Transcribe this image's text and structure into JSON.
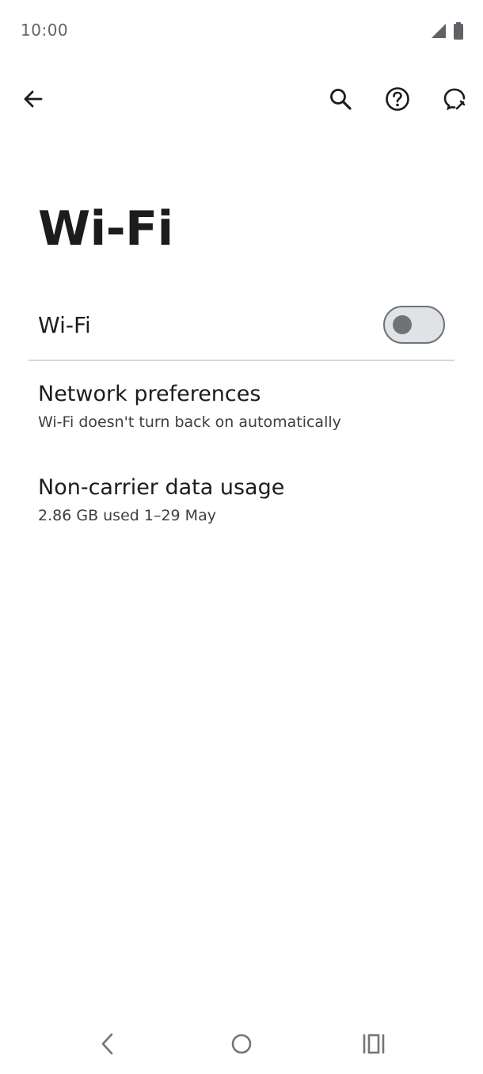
{
  "status_bar": {
    "time": "10:00",
    "icons": [
      "cellular-signal-icon",
      "battery-icon"
    ]
  },
  "app_bar": {
    "icons": [
      "back-arrow-icon",
      "search-icon",
      "help-icon",
      "feedback-icon"
    ]
  },
  "page": {
    "title": "Wi-Fi"
  },
  "wifi_toggle": {
    "label": "Wi-Fi",
    "state": "off"
  },
  "items": [
    {
      "title": "Network preferences",
      "subtitle": "Wi-Fi doesn't turn back on automatically"
    },
    {
      "title": "Non-carrier data usage",
      "subtitle": "2.86 GB used 1–29 May"
    }
  ],
  "nav_bar": {
    "icons": [
      "nav-back-icon",
      "nav-home-icon",
      "nav-recents-icon"
    ]
  },
  "colors": {
    "text_primary": "#1c1c1e",
    "text_secondary": "#3c4043",
    "switch_off_track": "#e0e3e5",
    "switch_off_thumb": "#6f7377",
    "divider": "#d5d7da"
  }
}
